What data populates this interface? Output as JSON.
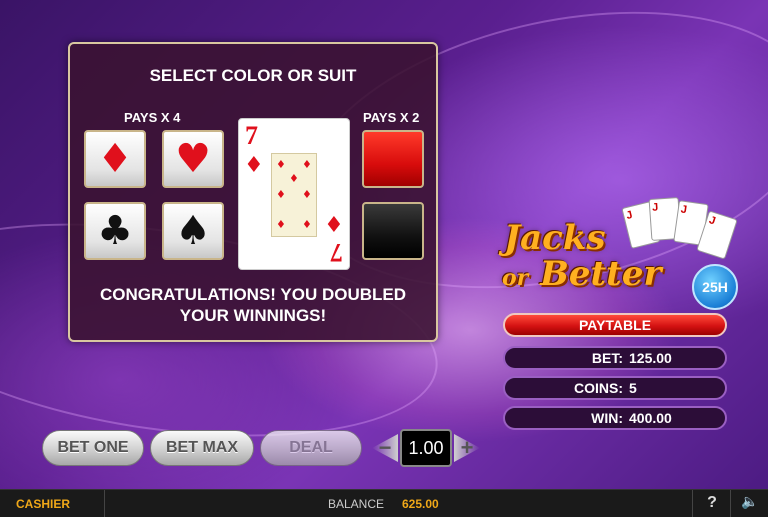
{
  "gamble": {
    "title": "SELECT COLOR OR SUIT",
    "pays_suit_label": "PAYS X 4",
    "pays_color_label": "PAYS X 2",
    "suits": [
      {
        "name": "diamonds",
        "glyph": "♦"
      },
      {
        "name": "hearts",
        "glyph": "♥"
      },
      {
        "name": "clubs",
        "glyph": "♣"
      },
      {
        "name": "spades",
        "glyph": "♠"
      }
    ],
    "card": {
      "rank": "7",
      "suit_glyph": "♦"
    },
    "message_line1": "CONGRATULATIONS! YOU DOUBLED",
    "message_line2": "YOUR WINNINGS!"
  },
  "logo": {
    "line1": "Jacks",
    "line2_or": "or",
    "line2_better": "Better",
    "badge": "25H",
    "mini_cards": [
      "J",
      "J",
      "J",
      "J"
    ]
  },
  "info": {
    "paytable_label": "PAYTABLE",
    "bet_label": "BET:",
    "bet_value": "125.00",
    "coins_label": "COINS:",
    "coins_value": "5",
    "win_label": "WIN:",
    "win_value": "400.00"
  },
  "controls": {
    "bet_one_label": "BET ONE",
    "bet_max_label": "BET MAX",
    "deal_label": "DEAL",
    "minus_glyph": "−",
    "plus_glyph": "+",
    "coin_value": "1.00"
  },
  "bottom_bar": {
    "cashier_label": "CASHIER",
    "balance_label": "BALANCE",
    "balance_value": "625.00",
    "help_glyph": "?",
    "sound_glyph": "🔈"
  },
  "colors": {
    "accent_gold": "#f0a818",
    "suit_red": "#e0101c",
    "paytable_red": "#d41212",
    "panel_border": "#d9c7a0"
  }
}
